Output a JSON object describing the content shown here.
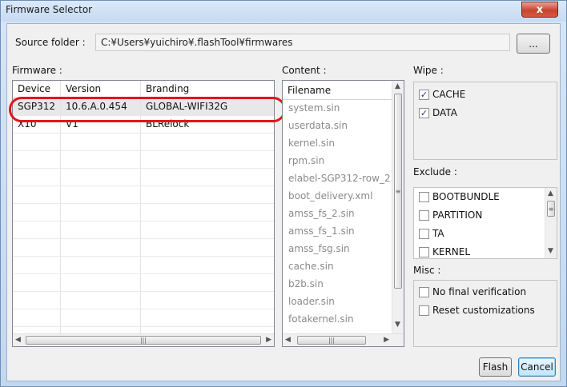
{
  "window": {
    "title": "Firmware Selector",
    "close_glyph": "x"
  },
  "source": {
    "label": "Source folder :",
    "path": "C:¥Users¥yuichiro¥.flashTool¥firmwares",
    "browse_label": "..."
  },
  "firmware": {
    "label": "Firmware :",
    "columns": [
      "Device",
      "Version",
      "Branding"
    ],
    "rows": [
      {
        "device": "SGP312",
        "version": "10.6.A.0.454",
        "branding": "GLOBAL-WIFI32G"
      },
      {
        "device": "X10",
        "version": "V1",
        "branding": "BLRelock"
      }
    ]
  },
  "content": {
    "label": "Content :",
    "column": "Filename",
    "files": [
      "system.sin",
      "userdata.sin",
      "kernel.sin",
      "rpm.sin",
      "elabel-SGP312-row_2...",
      "boot_delivery.xml",
      "amss_fs_2.sin",
      "amss_fs_1.sin",
      "amss_fsg.sin",
      "cache.sin",
      "b2b.sin",
      "loader.sin",
      "fotakernel.sin"
    ]
  },
  "wipe": {
    "label": "Wipe :",
    "items": [
      {
        "label": "CACHE",
        "checked": true
      },
      {
        "label": "DATA",
        "checked": true
      }
    ]
  },
  "exclude": {
    "label": "Exclude :",
    "items": [
      {
        "label": "BOOTBUNDLE",
        "checked": false
      },
      {
        "label": "PARTITION",
        "checked": false
      },
      {
        "label": "TA",
        "checked": false
      },
      {
        "label": "KERNEL",
        "checked": false
      }
    ]
  },
  "misc": {
    "label": "Misc :",
    "items": [
      {
        "label": "No final verification",
        "checked": false
      },
      {
        "label": "Reset customizations",
        "checked": false
      }
    ]
  },
  "buttons": {
    "flash": "Flash",
    "cancel": "Cancel"
  },
  "glyphs": {
    "arrow_left": "◀",
    "arrow_right": "▶",
    "arrow_up": "▲",
    "arrow_down": "▼",
    "grip_h": "|||",
    "grip_v": "≡",
    "check": "✓"
  },
  "colors": {
    "annotation_oval": "#e4141c",
    "selected_row": "#e8e8e8",
    "checkmark": "#1a3d8a"
  }
}
